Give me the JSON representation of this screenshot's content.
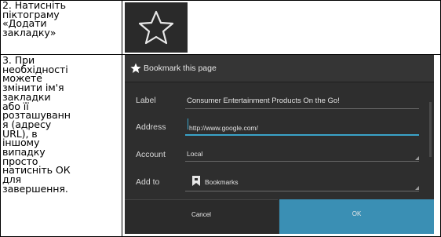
{
  "rows": [
    {
      "step_text": "2. Натисніть\nпіктограму\n«Додати\nзакладку»"
    },
    {
      "step_text": "3. При\nнеобхідності\nможете\nзмінити ім'я\nзакладки\nабо її\nрозташуванн\nя (адресу\nURL), в\nіншому\nвипадку\nпросто\nнатисніть ОК\nдля\nзавершення."
    }
  ],
  "star_icon": "star-outline-icon",
  "dialog": {
    "title": "Bookmark this page",
    "label_label": "Label",
    "label_value": "Consumer Entertainment Products On the Go!",
    "address_label": "Address",
    "address_value": "http://www.google.com/",
    "account_label": "Account",
    "account_value": "Local",
    "addto_label": "Add to",
    "addto_value": "Bookmarks",
    "cancel_label": "Cancel",
    "ok_label": "OK"
  },
  "colors": {
    "dialog_bg": "#2e2e2e",
    "accent": "#3a8fb4",
    "focus_line": "#3aa3c8"
  }
}
